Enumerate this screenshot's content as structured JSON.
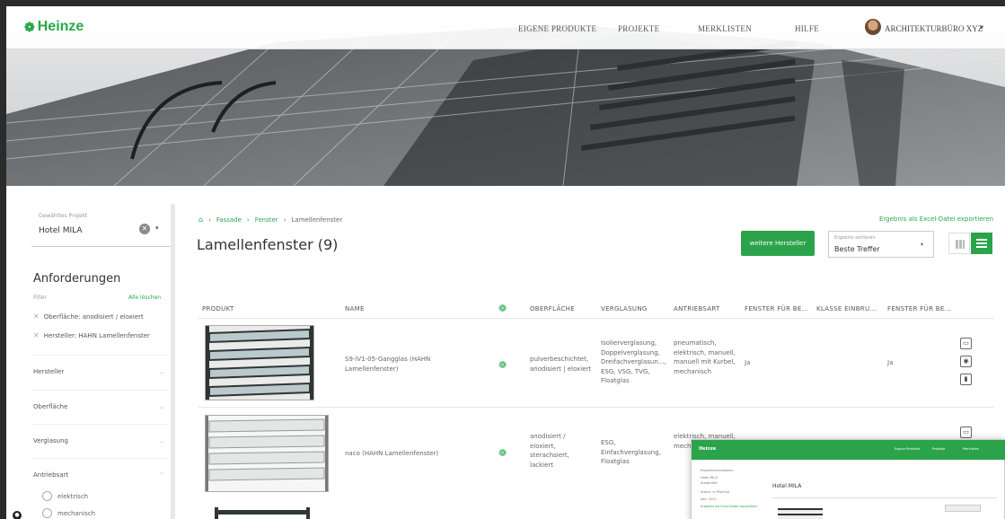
{
  "brand": {
    "logo_text": "Heinze",
    "accent": "#2aa84a"
  },
  "topnav": {
    "items": [
      "EIGENE PRODUKTE",
      "PROJEKTE",
      "MERKLISTEN",
      "HILFE"
    ],
    "user": "ARCHITEKTURBÜRO XYZ"
  },
  "sidebar": {
    "project_label": "Gewähltes Projekt",
    "project_value": "Hotel MILA",
    "requirements_title": "Anforderungen",
    "filter_label": "Filter",
    "clear_all": "Alle löschen",
    "chips": [
      "Oberfläche: anodisiert / eloxiert",
      "Hersteller: HAHN Lamellenfenster"
    ],
    "facets": [
      "Hersteller",
      "Oberfläche",
      "Verglasung",
      "Antriebsart"
    ],
    "radios": [
      "elektrisch",
      "mechanisch"
    ]
  },
  "breadcrumb": {
    "items": [
      "Fassade",
      "Fenster",
      "Lamellenfenster"
    ]
  },
  "page": {
    "title": "Lamellenfenster (9)",
    "export_link": "Ergebnis als Excel-Datei exportieren",
    "more_button": "weitere Hersteller",
    "sort_label": "Ergebnis sortieren",
    "sort_value": "Beste Treffer"
  },
  "table": {
    "headers": [
      "PRODUKT",
      "NAME",
      "OBERFLÄCHE",
      "VERGLASUNG",
      "ANTRIEBSART",
      "FENSTER FÜR BE...",
      "KLASSE EINBRU...",
      "FENSTER FÜR BE..."
    ],
    "rows": [
      {
        "name": "S9-iV1-05-Gangglas (HAHN Lamellenfenster)",
        "surface": "pulverbeschichtet, anodisiert | eloxiert",
        "glazing": "Isolierverglasung, Doppelverglasung, Dreifachverglasun..., ESG, VSG, TVG, Floatglas",
        "drive": "pneumatisch, elektrisch, manuell, manuell mit Kurbel, mechanisch",
        "window1": "Ja",
        "class": "",
        "window2": "Ja"
      },
      {
        "name": "naco (HAHN Lamellenfenster)",
        "surface": "anodisiert / eloxiert, sterachsiert, lackiert",
        "glazing": "ESG, Einfachverglasung, Floatglas",
        "drive": "elektrisch, manuell, mechanisch",
        "window1": "",
        "class": "",
        "window2": ""
      }
    ]
  },
  "popup": {
    "logo": "Heinze",
    "nav": [
      "Eigene Produkte",
      "Projekte",
      "Merklisten"
    ],
    "title": "Hotel MILA",
    "side_title": "Projektinformationen",
    "side_lines": [
      "Hotel MILA",
      "Stadtmitte",
      "Status: in Planung",
      "Jahr: 2021",
      "Ergebnis als Excel-Datei exportieren"
    ]
  }
}
